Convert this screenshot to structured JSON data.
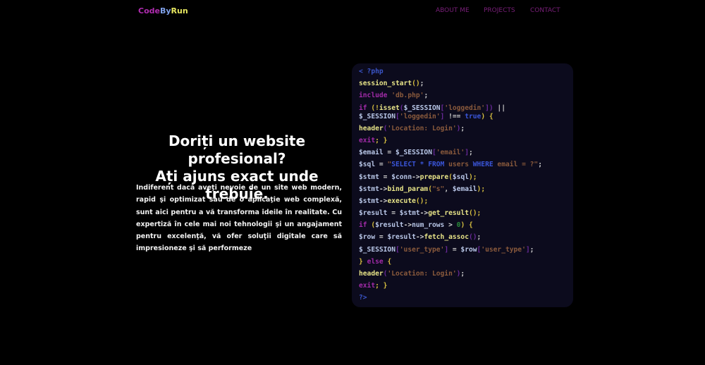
{
  "nav": {
    "logo": [
      "Code",
      "By",
      "Run"
    ],
    "links": [
      "ABOUT ME",
      "PROJECTS",
      "CONTACT"
    ]
  },
  "hero": {
    "line1": "Doriți un website profesional?",
    "line2": "Ați ajuns exact unde trebuie.",
    "paragraph": "Indiferent dacă aveţi nevoie de un site web modern, rapid şi optimizat sau de o aplicaţie web complexă, sunt aici pentru a vă transforma ideile în realitate. Cu expertiză în cele mai noi tehnologii şi un angajament pentru excelenţă, vă ofer soluţii digitale care să impresioneze şi să performeze"
  },
  "code": [
    [
      [
        "< ?php",
        "t"
      ]
    ],
    [
      [
        "session_start",
        "f"
      ],
      [
        "()",
        "y"
      ],
      [
        ";",
        "p"
      ]
    ],
    [
      [
        "include",
        "k"
      ],
      [
        " ",
        "p"
      ],
      [
        "'db.php'",
        "s"
      ],
      [
        ";",
        "p"
      ]
    ],
    [
      [
        "if",
        "k"
      ],
      [
        " (!",
        "y"
      ],
      [
        "isset",
        "f"
      ],
      [
        "(",
        "b"
      ],
      [
        "$_SESSION",
        "v"
      ],
      [
        "[",
        "b"
      ],
      [
        "'loggedin'",
        "s"
      ],
      [
        "])",
        "b"
      ],
      [
        " ||",
        "p"
      ]
    ],
    [
      [
        "$_SESSION",
        "v"
      ],
      [
        "[",
        "b"
      ],
      [
        "'loggedin'",
        "s"
      ],
      [
        "]",
        "b"
      ],
      [
        " !== ",
        "p"
      ],
      [
        "true",
        "q"
      ],
      [
        ") {",
        "y"
      ]
    ],
    [
      [
        "header",
        "f"
      ],
      [
        "(",
        "b"
      ],
      [
        "'Location: Login'",
        "s"
      ],
      [
        ")",
        "b"
      ],
      [
        ";",
        "p"
      ]
    ],
    [
      [
        "exit",
        "k"
      ],
      [
        "; }",
        "y"
      ]
    ],
    [
      [
        "$email",
        "v"
      ],
      [
        " = ",
        "p"
      ],
      [
        "$_SESSION",
        "v"
      ],
      [
        "[",
        "b"
      ],
      [
        "'email'",
        "s"
      ],
      [
        "]",
        "b"
      ],
      [
        ";",
        "p"
      ]
    ],
    [
      [
        "$sql",
        "v"
      ],
      [
        " = ",
        "p"
      ],
      [
        "\"",
        "s"
      ],
      [
        "SELECT * FROM",
        "q"
      ],
      [
        " users ",
        "s"
      ],
      [
        "WHERE",
        "q"
      ],
      [
        " email = ?\"",
        "s"
      ],
      [
        ";",
        "p"
      ]
    ],
    [
      [
        "$stmt",
        "v"
      ],
      [
        " = ",
        "p"
      ],
      [
        "$conn",
        "v"
      ],
      [
        "->",
        "p"
      ],
      [
        "prepare",
        "f"
      ],
      [
        "(",
        "y"
      ],
      [
        "$sql",
        "v"
      ],
      [
        ");",
        "y"
      ]
    ],
    [
      [
        "$stmt",
        "v"
      ],
      [
        "->",
        "p"
      ],
      [
        "bind_param",
        "f"
      ],
      [
        "(",
        "y"
      ],
      [
        "\"s\"",
        "s"
      ],
      [
        ", ",
        "p"
      ],
      [
        "$email",
        "v"
      ],
      [
        ");",
        "y"
      ]
    ],
    [
      [
        "$stmt",
        "v"
      ],
      [
        "->",
        "p"
      ],
      [
        "execute",
        "f"
      ],
      [
        "();",
        "y"
      ]
    ],
    [
      [
        "$result",
        "v"
      ],
      [
        " = ",
        "p"
      ],
      [
        "$stmt",
        "v"
      ],
      [
        "->",
        "p"
      ],
      [
        "get_result",
        "f"
      ],
      [
        "();",
        "y"
      ]
    ],
    [
      [
        "if",
        "k"
      ],
      [
        " (",
        "y"
      ],
      [
        "$result",
        "v"
      ],
      [
        "->",
        "p"
      ],
      [
        "num_rows",
        "v"
      ],
      [
        " > ",
        "p"
      ],
      [
        "0",
        "n"
      ],
      [
        ") {",
        "y"
      ]
    ],
    [
      [
        "$row",
        "v"
      ],
      [
        " = ",
        "p"
      ],
      [
        "$result",
        "v"
      ],
      [
        "->",
        "p"
      ],
      [
        "fetch_assoc",
        "f"
      ],
      [
        "()",
        "b"
      ],
      [
        ";",
        "p"
      ]
    ],
    [
      [
        "$_SESSION",
        "v"
      ],
      [
        "[",
        "b"
      ],
      [
        "'user_type'",
        "s"
      ],
      [
        "]",
        "b"
      ],
      [
        " = ",
        "p"
      ],
      [
        "$row",
        "v"
      ],
      [
        "[",
        "b"
      ],
      [
        "'user_type'",
        "s"
      ],
      [
        "]",
        "b"
      ],
      [
        ";",
        "p"
      ]
    ],
    [
      [
        "} ",
        "y"
      ],
      [
        "else",
        "k"
      ],
      [
        " {",
        "y"
      ]
    ],
    [
      [
        "header",
        "f"
      ],
      [
        "(",
        "b"
      ],
      [
        "'Location: Login'",
        "s"
      ],
      [
        ")",
        "b"
      ],
      [
        ";",
        "p"
      ]
    ],
    [
      [
        "exit",
        "k"
      ],
      [
        "; }",
        "y"
      ]
    ],
    [
      [
        "?>",
        "t"
      ]
    ]
  ]
}
